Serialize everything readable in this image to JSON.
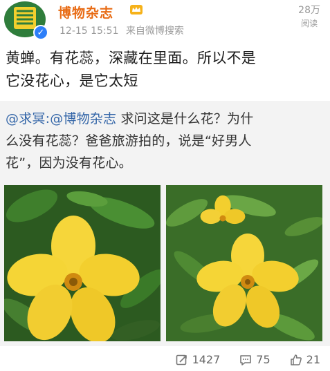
{
  "post": {
    "username": "博物杂志",
    "date": "12-15 15:51",
    "source": "来自微博搜索",
    "read_count": "28万",
    "read_label": "阅读",
    "text_line1": "黄蝉。有花蕊，深藏在里面。所以不是",
    "text_line2": "它没花心，是它太短"
  },
  "retweet": {
    "user_mention": "@求冥:@博物杂志",
    "text_part1": " 求问这是什么花？为什",
    "text_line2": "么没有花蕊？爸爸旅游拍的，说是“好男人",
    "text_line3": "花”，因为没有花心。"
  },
  "actions": {
    "repost_count": "1427",
    "comment_count": "75",
    "like_count": "21"
  },
  "colors": {
    "username": "#e86b14",
    "mention": "#3466a8",
    "verified": "#2d7ff9"
  }
}
